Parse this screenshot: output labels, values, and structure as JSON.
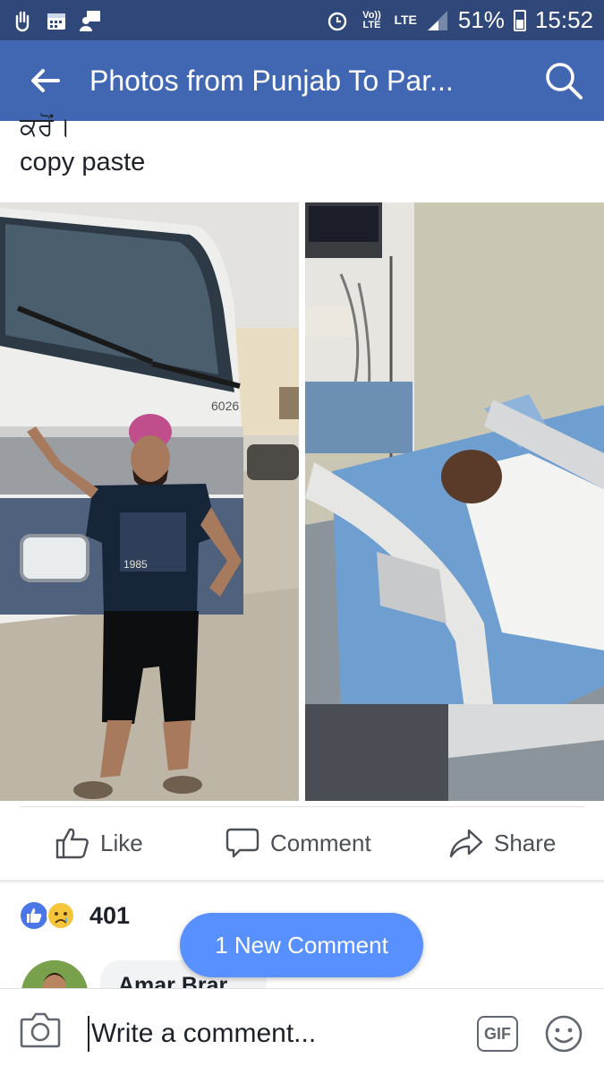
{
  "status_bar": {
    "volte": "Vo)) LTE",
    "network": "LTE",
    "battery": "51%",
    "time": "15:52"
  },
  "app_bar": {
    "title": "Photos from Punjab To Par..."
  },
  "post": {
    "text_line1": "ਕਰੋਂ।",
    "text_line2": "copy paste"
  },
  "actions": {
    "like_label": "Like",
    "comment_label": "Comment",
    "share_label": "Share"
  },
  "reactions": {
    "count": "401",
    "types": [
      "like",
      "sad"
    ]
  },
  "comment": {
    "author": "Amar Brar"
  },
  "new_comment_pill": {
    "label": "1 New Comment"
  },
  "composer": {
    "placeholder": "Write a comment...",
    "gif_label": "GIF"
  },
  "colors": {
    "status_bar": "#2f4779",
    "app_bar": "#4267b2",
    "pill": "#5890ff"
  }
}
